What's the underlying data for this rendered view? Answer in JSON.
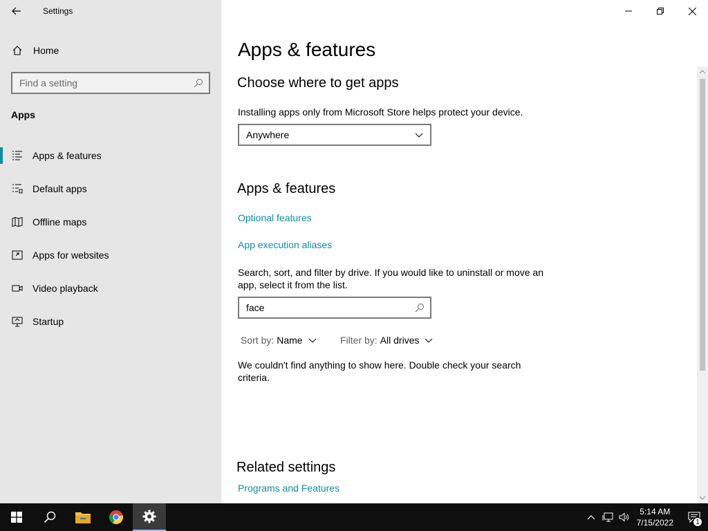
{
  "window": {
    "title": "Settings"
  },
  "sidebar": {
    "home_label": "Home",
    "search_placeholder": "Find a setting",
    "section_heading": "Apps",
    "items": [
      {
        "label": "Apps & features",
        "icon": "apps-features-icon",
        "active": true
      },
      {
        "label": "Default apps",
        "icon": "default-apps-icon",
        "active": false
      },
      {
        "label": "Offline maps",
        "icon": "map-icon",
        "active": false
      },
      {
        "label": "Apps for websites",
        "icon": "open-in-app-icon",
        "active": false
      },
      {
        "label": "Video playback",
        "icon": "video-icon",
        "active": false
      },
      {
        "label": "Startup",
        "icon": "startup-icon",
        "active": false
      }
    ]
  },
  "main": {
    "page_title": "Apps & features",
    "source_heading": "Choose where to get apps",
    "source_desc": "Installing apps only from Microsoft Store helps protect your device.",
    "source_value": "Anywhere",
    "apps_heading": "Apps & features",
    "optional_features_link": "Optional features",
    "aliases_link": "App execution aliases",
    "search_desc": "Search, sort, and filter by drive. If you would like to uninstall or move an app, select it from the list.",
    "search_value": "face",
    "sort_label": "Sort by:",
    "sort_value": "Name",
    "filter_label": "Filter by:",
    "filter_value": "All drives",
    "empty_message": "We couldn't find anything to show here. Double check your search criteria.",
    "related_heading": "Related settings",
    "programs_link": "Programs and Features"
  },
  "taskbar": {
    "time": "5:14 AM",
    "date": "7/15/2022",
    "notification_count": "1"
  },
  "colors": {
    "accent": "#0a8ea3",
    "sidebar_bg": "#e6e6e6",
    "taskbar_bg": "#0f0f0f"
  }
}
